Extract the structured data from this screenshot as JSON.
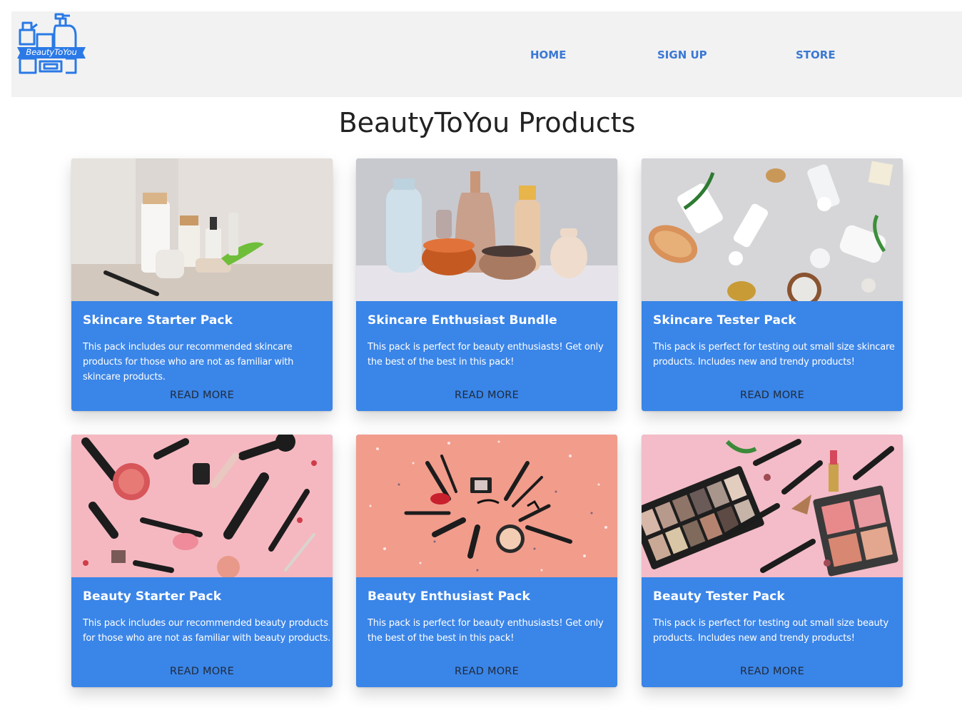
{
  "brand": {
    "logo_text": "BeautyToYou",
    "accent_color": "#3a85e8"
  },
  "nav": {
    "home": "HOME",
    "signup": "SIGN UP",
    "store": "STORE"
  },
  "page": {
    "title": "BeautyToYou Products"
  },
  "cards": [
    {
      "title": "Skincare Starter Pack",
      "description": "This pack includes our recommended skincare products for those who are not as familiar with skincare products.",
      "action": "READ MORE"
    },
    {
      "title": "Skincare Enthusiast Bundle",
      "description": "This pack is perfect for beauty enthusiasts! Get only the best of the best in this pack!",
      "action": "READ MORE"
    },
    {
      "title": "Skincare Tester Pack",
      "description": "This pack is perfect for testing out small size skincare products. Includes new and trendy products!",
      "action": "READ MORE"
    },
    {
      "title": "Beauty Starter Pack",
      "description": "This pack includes our recommended beauty products for those who are not as familiar with beauty products.",
      "action": "READ MORE"
    },
    {
      "title": "Beauty Enthusiast Pack",
      "description": "This pack is perfect for beauty enthusiasts! Get only the best of the best in this pack!",
      "action": "READ MORE"
    },
    {
      "title": "Beauty Tester Pack",
      "description": "This pack is perfect for testing out small size beauty products. Includes new and trendy products!",
      "action": "READ MORE"
    }
  ]
}
